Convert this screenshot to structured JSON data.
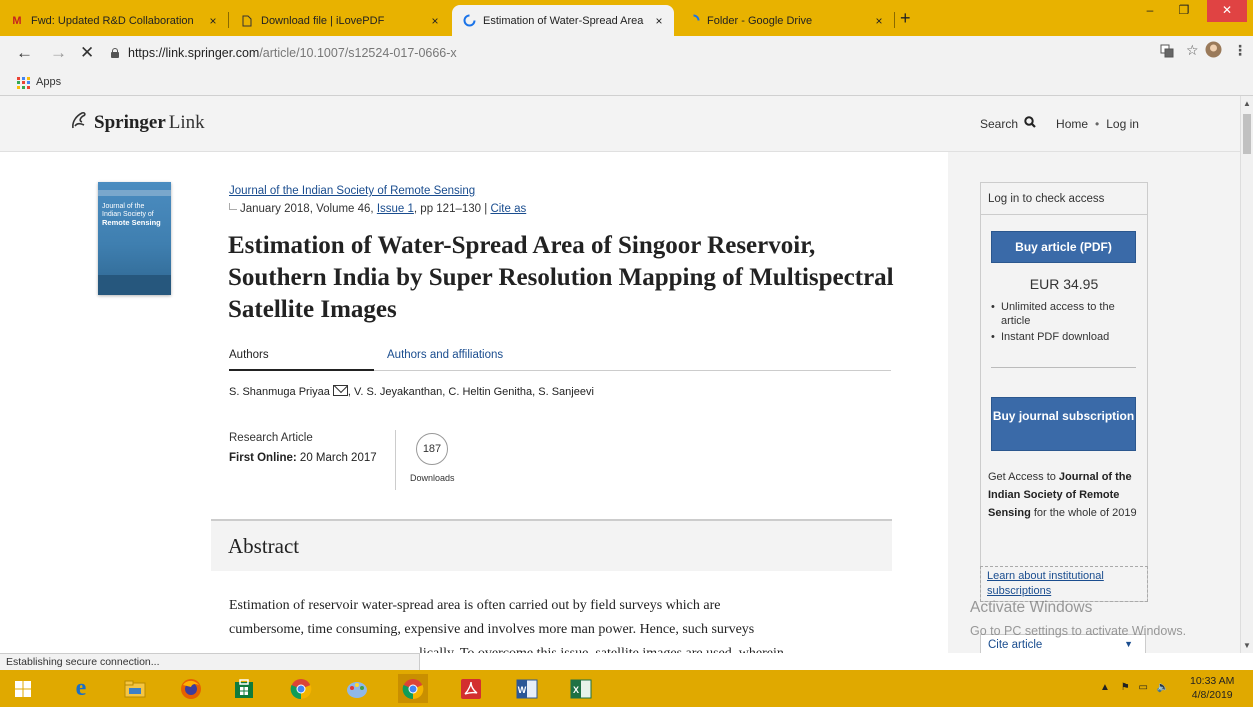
{
  "browser": {
    "tabs": [
      {
        "label": "Fwd: Updated R&D Collaboration",
        "icon": "gmail-icon",
        "close": "×"
      },
      {
        "label": "Download file | iLovePDF",
        "icon": "page-icon",
        "close": "×"
      },
      {
        "label": "Estimation of Water-Spread Area",
        "icon": "loading-icon",
        "close": "×"
      },
      {
        "label": "Folder - Google Drive",
        "icon": "loading-icon",
        "close": "×"
      }
    ],
    "new_tab": "+",
    "url_host": "https://link.springer.com",
    "url_path": "/article/10.1007/s12524-017-0666-x",
    "bookmarks_apps": "Apps",
    "status": "Establishing secure connection..."
  },
  "site": {
    "logo_springer": "Springer",
    "logo_link": "Link",
    "nav": {
      "search": "Search",
      "home": "Home",
      "dot": "•",
      "login": "Log in"
    }
  },
  "article": {
    "cover": {
      "line1": "Journal of the",
      "line2": "Indian Society of",
      "line3": "Remote Sensing"
    },
    "journal": "Journal of the Indian Society of Remote Sensing",
    "pub_prefix": "January 2018, Volume 46, ",
    "issue": "Issue 1",
    "pages": ", pp 121–130 | ",
    "cite_as": "Cite as",
    "title": "Estimation of Water-Spread Area of Singoor Reservoir, Southern India by Super Resolution Mapping of Multispectral Satellite Images",
    "tab_authors": "Authors",
    "tab_affiliations": "Authors and affiliations",
    "author1": "S. Shanmuga Priyaa",
    "authors_rest": ", V. S. Jeyakanthan, C. Heltin Genitha, S. Sanjeevi",
    "type": "Research Article",
    "first_online_label": "First Online:",
    "first_online_date": " 20 March 2017",
    "downloads_count": "187",
    "downloads_label": "Downloads",
    "abstract_heading": "Abstract",
    "abstract_line1": "Estimation of reservoir water-spread area is often carried out by field surveys which are",
    "abstract_line2": "cumbersome, time consuming, expensive and involves more man power. Hence, such surveys",
    "abstract_line3": "lically. To overcome this issue, satellite images are used, wherein"
  },
  "sidebar": {
    "login_check": "Log in to check access",
    "buy_article": "Buy article (PDF)",
    "price": "EUR 34.95",
    "benefits": [
      "Unlimited access to the article",
      "Instant PDF download"
    ],
    "buy_journal": "Buy journal subscription",
    "access_prefix": "Get Access to ",
    "access_journal": "Journal of the Indian Society of Remote Sensing",
    "access_suffix": " for the whole of 2019",
    "learn_institutional": "Learn about institutional subscriptions",
    "cite_article": "Cite article",
    "cite_arrow": "▼"
  },
  "watermark": {
    "line1": "Activate Windows",
    "line2": "Go to PC settings to activate Windows."
  },
  "taskbar": {
    "time": "10:33 AM",
    "date": "4/8/2019"
  },
  "colors": {
    "chrome_frame": "#e8b200",
    "taskbar": "#e0a900",
    "springer_blue": "#3a6aa8",
    "link_blue": "#1a4d8f"
  }
}
